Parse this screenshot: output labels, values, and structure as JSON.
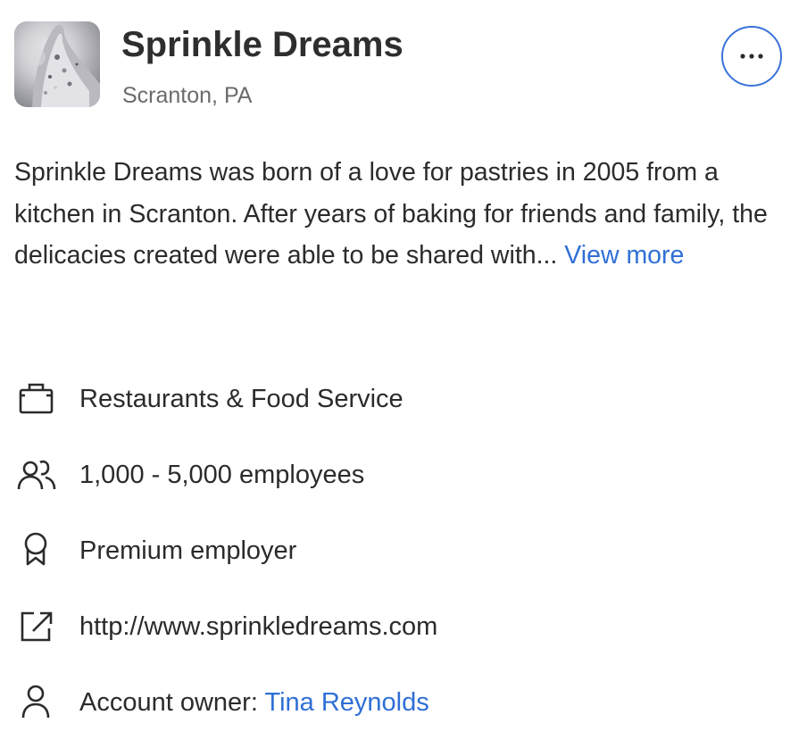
{
  "company": {
    "name": "Sprinkle Dreams",
    "location": "Scranton, PA"
  },
  "description": {
    "text": "Sprinkle Dreams was born of a love for pastries in 2005 from a kitchen in Scranton. After years of baking for friends and family, the delicacies created were able to be shared with...",
    "view_more_label": "View more"
  },
  "details": {
    "industry": "Restaurants & Food Service",
    "employees": "1,000 - 5,000 employees",
    "premium": "Premium employer",
    "website": "http://www.sprinkledreams.com",
    "owner_label": "Account owner:",
    "owner_name": "Tina Reynolds"
  },
  "icons": {
    "more": "more-horizontal-icon",
    "industry": "briefcase-icon",
    "employees": "people-icon",
    "premium": "award-ribbon-icon",
    "website": "external-link-icon",
    "owner": "person-icon"
  },
  "colors": {
    "accent": "#2f6fd6",
    "title": "#2e2e2e",
    "muted": "#6b6b6b",
    "text": "#2b2b2b"
  }
}
